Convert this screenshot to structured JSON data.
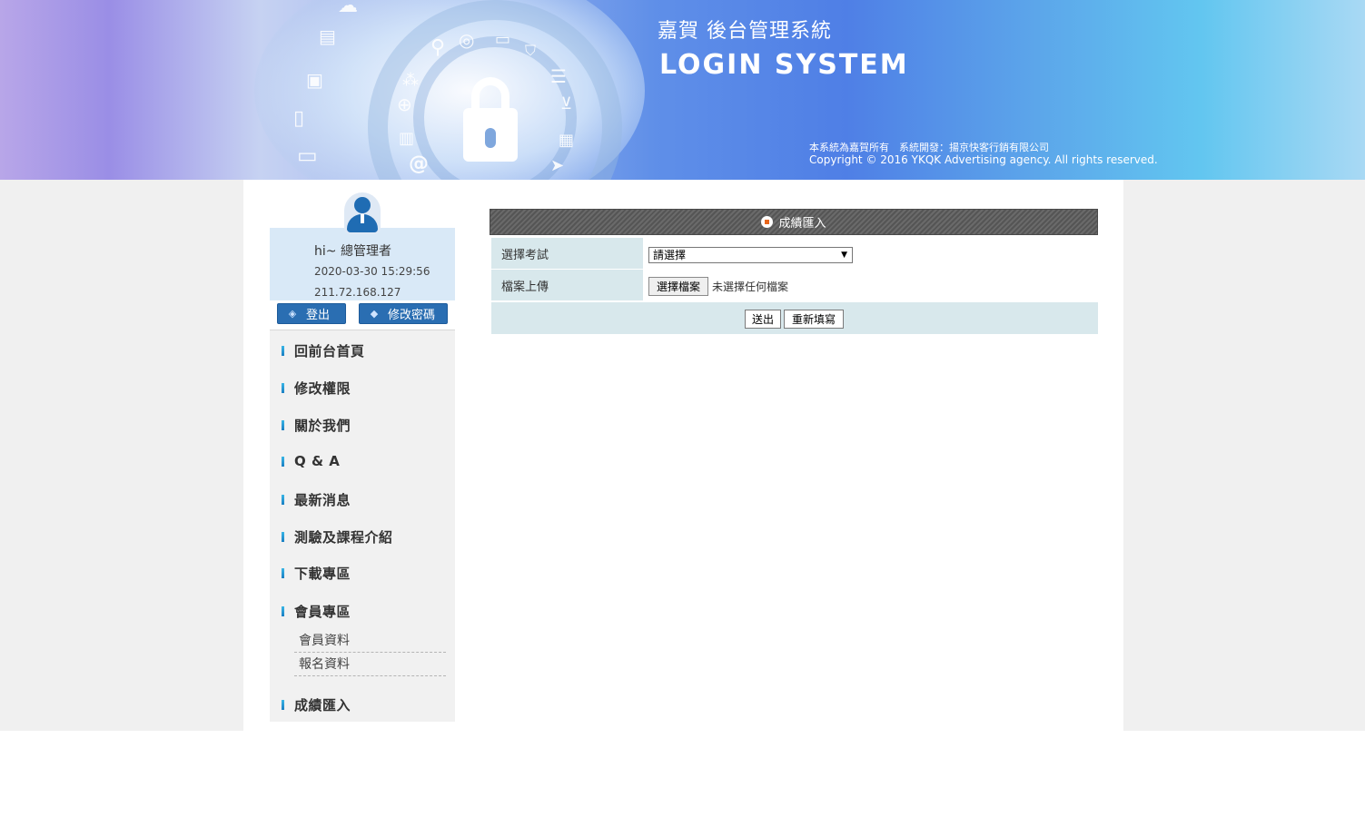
{
  "header": {
    "title": "嘉賀 後台管理系統",
    "subtitle": "LOGIN SYSTEM",
    "owner": "本系統為嘉賀所有　系統開發：揚京快客行銷有限公司",
    "copyright": "Copyright © 2016 YKQK Advertising agency. All rights reserved.",
    "icons": [
      "cloud-icon",
      "printer-icon",
      "search-icon",
      "target-icon",
      "image-icon",
      "shield-icon",
      "photo-icon",
      "network-icon",
      "server-icon",
      "tablet-icon",
      "globe-icon",
      "cart-icon",
      "briefcase-icon",
      "calendar-icon",
      "laptop-icon",
      "at-icon",
      "cursor-icon",
      "lock-icon"
    ]
  },
  "user": {
    "greeting": "hi~ 總管理者",
    "datetime": "2020-03-30 15:29:56",
    "ip": "211.72.168.127",
    "logout_label": "登出",
    "change_password_label": "修改密碼"
  },
  "menu": {
    "items": [
      {
        "label": "回前台首頁"
      },
      {
        "label": "修改權限"
      },
      {
        "label": "關於我們"
      },
      {
        "label": "Q & A"
      },
      {
        "label": "最新消息"
      },
      {
        "label": "測驗及課程介紹"
      },
      {
        "label": "下載專區"
      },
      {
        "label": "會員專區"
      },
      {
        "label": "成績匯入"
      }
    ],
    "sub_items": [
      {
        "label": "會員資料"
      },
      {
        "label": "報名資料"
      }
    ]
  },
  "form": {
    "title": "成績匯入",
    "exam_label": "選擇考試",
    "exam_selected": "請選擇",
    "file_label": "檔案上傳",
    "file_button": "選擇檔案",
    "file_status": "未選擇任何檔案",
    "submit_label": "送出",
    "reset_label": "重新填寫"
  },
  "colors": {
    "accent_blue": "#2a6eb2",
    "title_bar": "#555555",
    "label_bg": "#d8e8ec",
    "orange_dot": "#e8661c"
  }
}
